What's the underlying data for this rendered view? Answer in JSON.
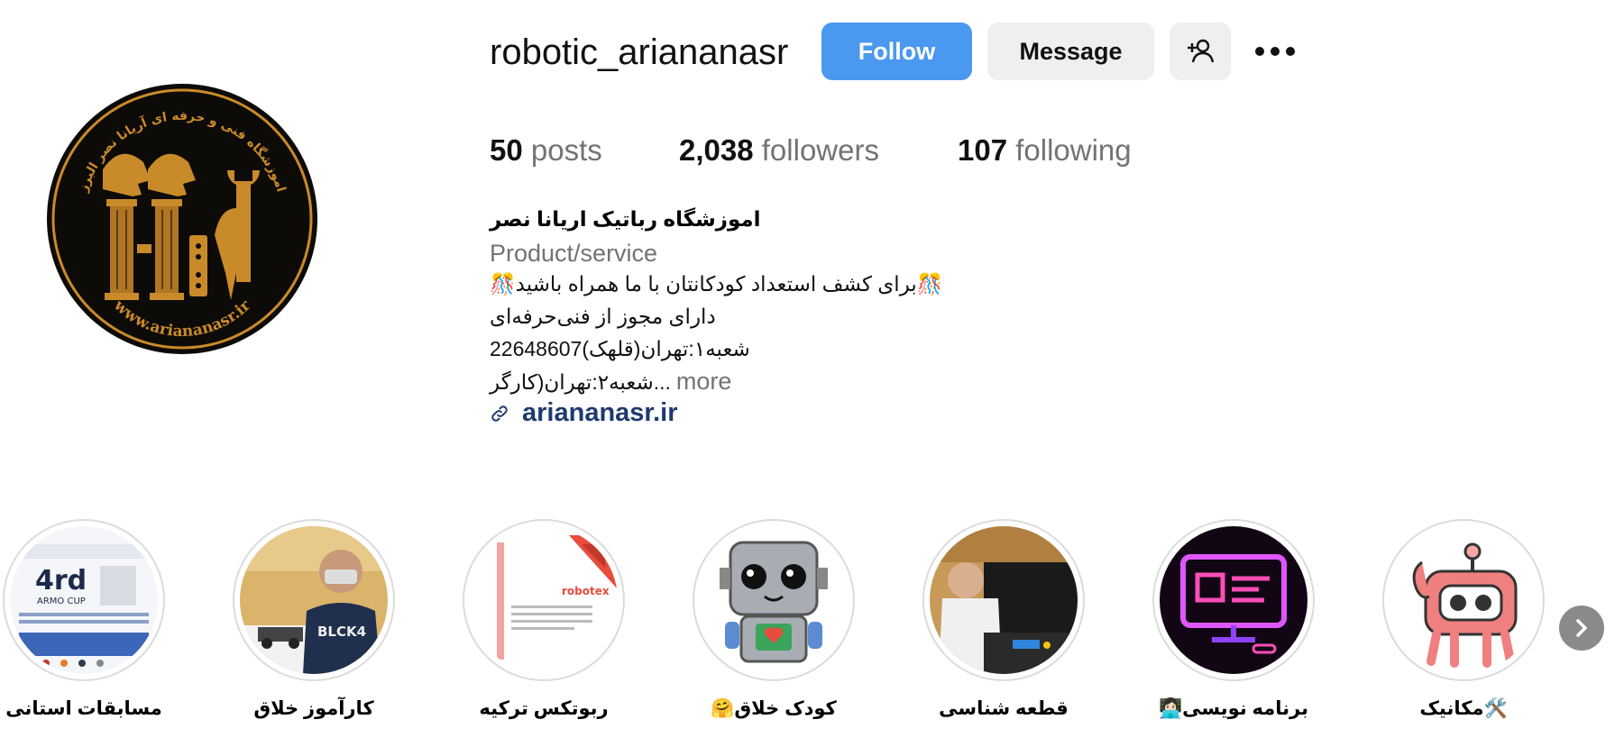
{
  "profile": {
    "username": "robotic_ariananasr",
    "follow_label": "Follow",
    "message_label": "Message",
    "add_user_icon": "add-user-icon",
    "more_icon": "more-options-icon"
  },
  "stats": {
    "posts_count": "50",
    "posts_label": "posts",
    "followers_count": "2,038",
    "followers_label": "followers",
    "following_count": "107",
    "following_label": "following"
  },
  "bio": {
    "name": "اموزشگاه رباتیک اریانا نصر",
    "category": "Product/service",
    "line1": "🎊برای کشف استعداد کودکانتان با ما همراه باشید🎊",
    "line2": "دارای مجوز از فنی‌حرفه‌ای",
    "line3": "شعبه۱:تهران(قلهک)22648607",
    "line4": "...شعبه۲:تهران(کارگر",
    "more_label": "more",
    "link": "ariananasr.ir",
    "link_icon": "link-icon"
  },
  "avatar": {
    "ring_text": "اموزشگاه فنی و حرفه ای آریانا نصر البرز",
    "url_text": "www.ariananasr.ir"
  },
  "highlights": [
    {
      "label": "مسابقات استانی"
    },
    {
      "label": "کارآموز خلاق"
    },
    {
      "label": "ربوتکس ترکیه"
    },
    {
      "label": "کودک خلاق🤗"
    },
    {
      "label": "قطعه شناسی"
    },
    {
      "label": "برنامه نویسی👩🏻‍💻"
    },
    {
      "label": "🛠️مکانیک"
    }
  ],
  "highlight_art": {
    "h1_title": "4rd",
    "h1_sub": "ARMO CUP",
    "h2_shirt_text": "BLCK4",
    "h3_brand": "robotex"
  },
  "colors": {
    "follow_bg": "#4a98f0",
    "link": "#1e3a6e",
    "muted": "#737373",
    "avatar_gold": "#c98a2a"
  }
}
